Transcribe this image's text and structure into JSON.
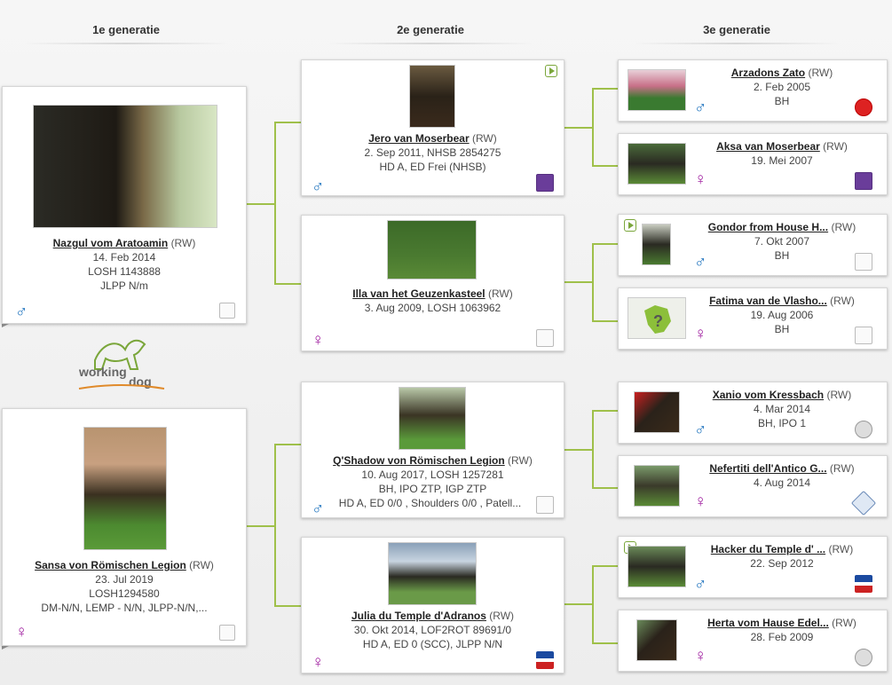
{
  "headers": {
    "gen1": "1e generatie",
    "gen2": "2e generatie",
    "gen3": "3e generatie"
  },
  "logo_text": {
    "part1": "working",
    "part2": "dog"
  },
  "gen1": [
    {
      "name": "Nazgul vom Aratoamin",
      "reg": "(RW)",
      "lines": [
        "14. Feb 2014",
        "LOSH 1143888",
        "JLPP N/m"
      ],
      "sex": "♂"
    },
    {
      "name": "Sansa von Römischen Legion",
      "reg": "(RW)",
      "lines": [
        "23. Jul 2019",
        "LOSH1294580",
        "DM-N/N, LEMP - N/N, JLPP-N/N,..."
      ],
      "sex": "♀"
    }
  ],
  "gen2": [
    {
      "name": "Jero van Moserbear",
      "reg": "(RW)",
      "lines": [
        "2. Sep 2011, NHSB 2854275",
        "HD A, ED Frei (NHSB)"
      ],
      "sex": "♂"
    },
    {
      "name": "Illa van het Geuzenkasteel",
      "reg": "(RW)",
      "lines": [
        "3. Aug 2009, LOSH 1063962"
      ],
      "sex": "♀"
    },
    {
      "name": "Q'Shadow von Römischen Legion",
      "reg": "(RW)",
      "lines": [
        "10. Aug 2017, LOSH 1257281",
        "BH, IPO ZTP, IGP ZTP",
        "HD A, ED 0/0 , Shoulders 0/0 , Patell..."
      ],
      "sex": "♂"
    },
    {
      "name": "Julia du Temple d'Adranos",
      "reg": "(RW)",
      "lines": [
        "30. Okt 2014, LOF2ROT 89691/0",
        "HD A, ED 0 (SCC), JLPP N/N"
      ],
      "sex": "♀"
    }
  ],
  "gen3": [
    {
      "name": "Arzadons Zato",
      "reg": "(RW)",
      "lines": [
        "2. Feb 2005",
        "BH"
      ],
      "sex": "♂"
    },
    {
      "name": "Aksa van Moserbear",
      "reg": "(RW)",
      "lines": [
        "19. Mei 2007"
      ],
      "sex": "♀"
    },
    {
      "name": "Gondor from House H...",
      "reg": "(RW)",
      "lines": [
        "7. Okt 2007",
        "BH"
      ],
      "sex": "♂"
    },
    {
      "name": "Fatima van de Vlasho...",
      "reg": "(RW)",
      "lines": [
        "19. Aug 2006",
        "BH"
      ],
      "sex": "♀"
    },
    {
      "name": "Xanio vom Kressbach",
      "reg": "(RW)",
      "lines": [
        "4. Mar 2014",
        "BH, IPO 1"
      ],
      "sex": "♂"
    },
    {
      "name": "Nefertiti dell'Antico G...",
      "reg": "(RW)",
      "lines": [
        "4. Aug 2014"
      ],
      "sex": "♀"
    },
    {
      "name": "Hacker du Temple d' ...",
      "reg": "(RW)",
      "lines": [
        "22. Sep 2012"
      ],
      "sex": "♂"
    },
    {
      "name": "Herta vom Hause Edel...",
      "reg": "(RW)",
      "lines": [
        "28. Feb 2009"
      ],
      "sex": "♀"
    }
  ],
  "colors": {
    "male": "#1e73be",
    "female": "#a020a0",
    "connector": "#9fc04a",
    "accent": "#7aa63a"
  },
  "icons": [
    "male-icon",
    "female-icon",
    "video-play-icon",
    "registry-badge-icon"
  ]
}
